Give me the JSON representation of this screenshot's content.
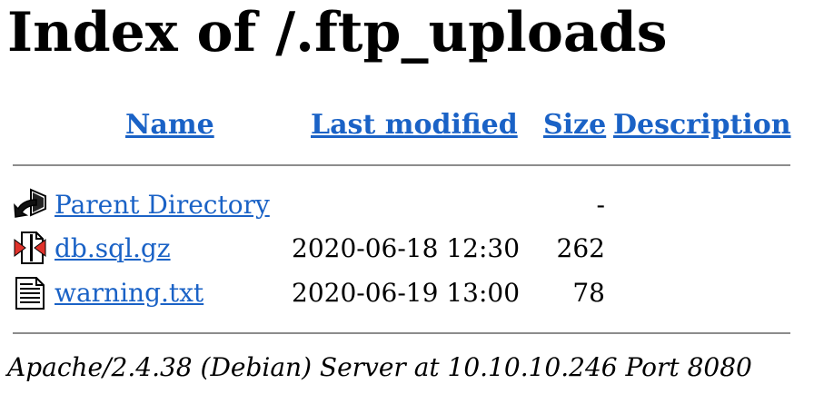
{
  "page_title": "Index of /.ftp_uploads",
  "columns": {
    "name": "Name",
    "last_modified": "Last modified",
    "size": "Size",
    "description": "Description"
  },
  "entries": [
    {
      "name": "Parent Directory",
      "last_modified": "",
      "size": "-",
      "icon": "back-arrow-icon"
    },
    {
      "name": "db.sql.gz",
      "last_modified": "2020-06-18 12:30",
      "size": "262",
      "icon": "compressed-file-icon"
    },
    {
      "name": "warning.txt",
      "last_modified": "2020-06-19 13:00",
      "size": "78",
      "icon": "text-file-icon"
    }
  ],
  "footer": "Apache/2.4.38 (Debian) Server at 10.10.10.246 Port 8080",
  "colors": {
    "link": "#1a62c6",
    "rule": "#8c8c8c",
    "compressed_accent": "#e0322b"
  }
}
